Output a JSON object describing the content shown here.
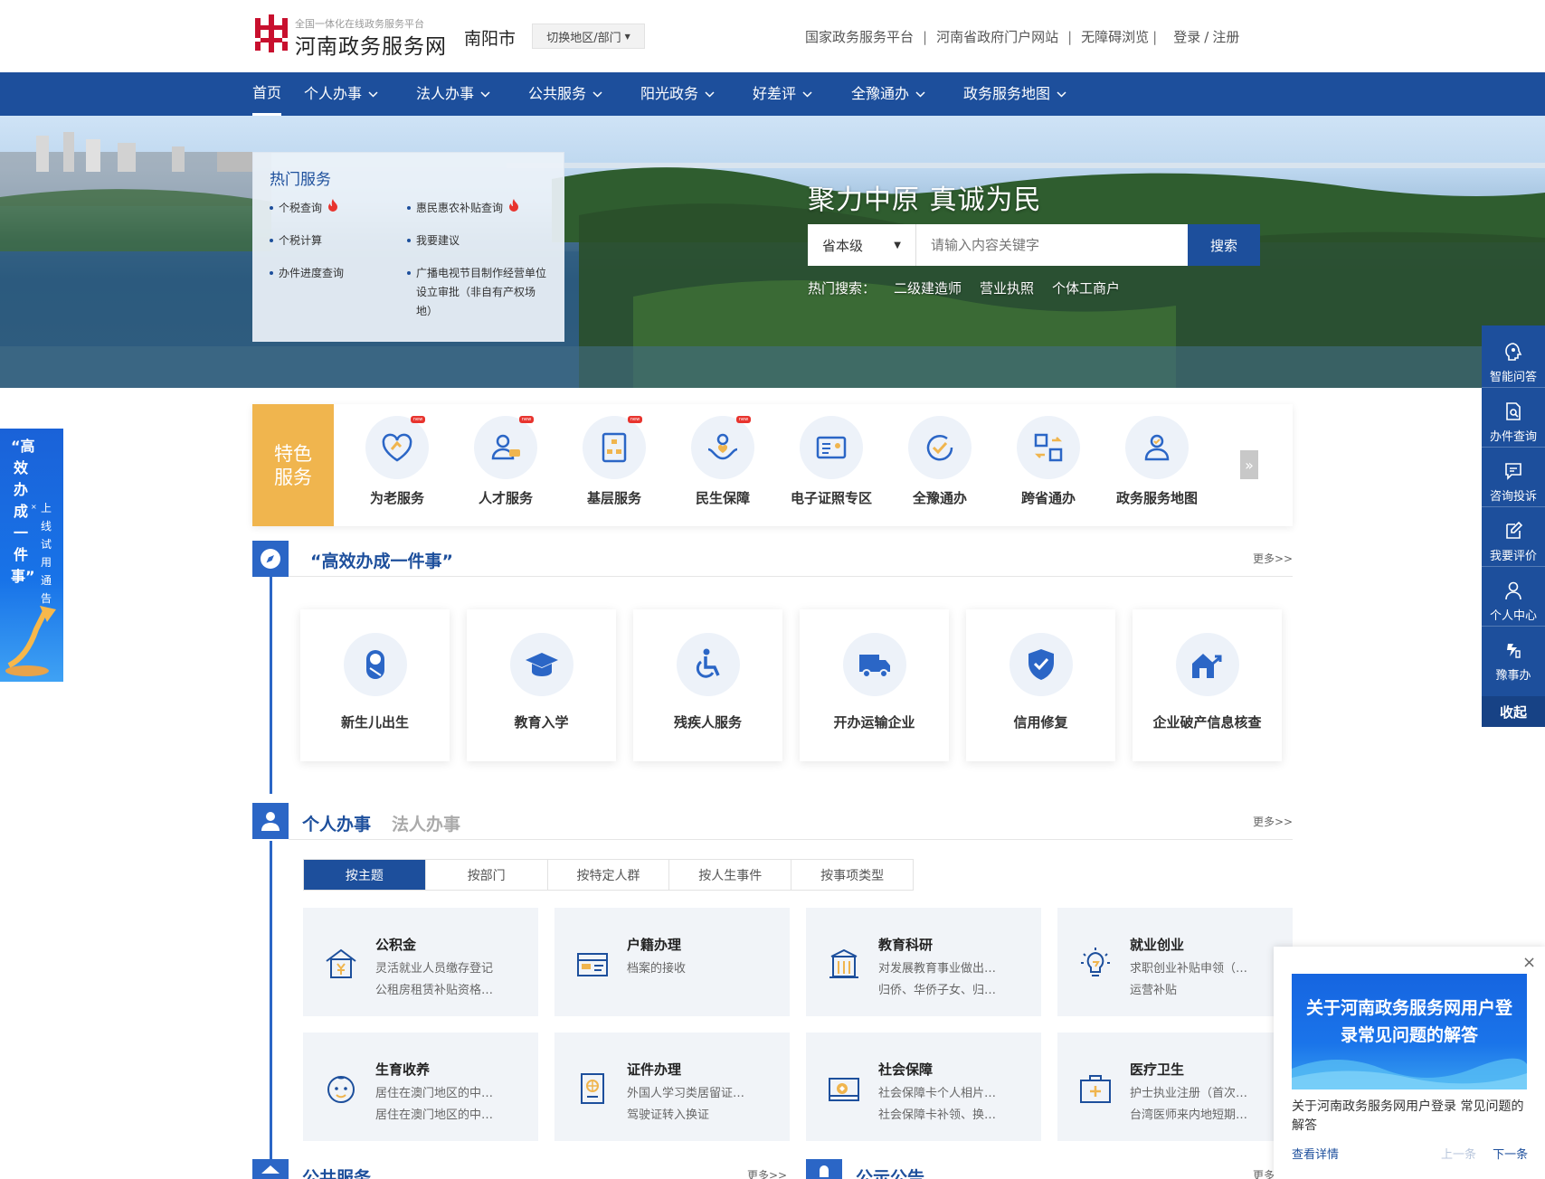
{
  "header": {
    "logo_sub": "全国一体化在线政务服务平台",
    "logo_title": "河南政务服务网",
    "city": "南阳市",
    "switch_label": "切换地区/部门",
    "links": [
      "国家政务服务平台",
      "河南省政府门户网站",
      "无障碍浏览"
    ],
    "login": "登录",
    "register": "注册"
  },
  "nav": {
    "items": [
      "首页",
      "个人办事",
      "法人办事",
      "公共服务",
      "阳光政务",
      "好差评",
      "全豫通办",
      "政务服务地图"
    ]
  },
  "hot_services": {
    "title": "热门服务",
    "items": [
      "个税查询",
      "惠民惠农补贴查询",
      "个税计算",
      "我要建议",
      "办件进度查询",
      "广播电视节目制作经营单位设立审批（非自有产权场地）"
    ]
  },
  "search": {
    "slogan": "聚力中原  真诚为民",
    "level": "省本级",
    "placeholder": "请输入内容关键字",
    "button": "搜索",
    "hot_label": "热门搜索：",
    "hot_terms": [
      "二级建造师",
      "营业执照",
      "个体工商户"
    ]
  },
  "featured": {
    "label_line1": "特色",
    "label_line2": "服务",
    "items": [
      "为老服务",
      "人才服务",
      "基层服务",
      "民生保障",
      "电子证照专区",
      "全豫通办",
      "跨省通办",
      "政务服务地图"
    ],
    "badge": "new"
  },
  "one_thing": {
    "title": "“高效办成一件事”",
    "more": "更多>>",
    "items": [
      "新生儿出生",
      "教育入学",
      "残疾人服务",
      "开办运输企业",
      "信用修复",
      "企业破产信息核查"
    ]
  },
  "affairs": {
    "title_active": "个人办事",
    "title_inactive": "法人办事",
    "more": "更多>>",
    "tabs": [
      "按主题",
      "按部门",
      "按特定人群",
      "按人生事件",
      "按事项类型"
    ],
    "cards": [
      {
        "title": "公积金",
        "line1": "灵活就业人员缴存登记",
        "line2": "公租房租赁补贴资格…"
      },
      {
        "title": "户籍办理",
        "line1": "档案的接收",
        "line2": ""
      },
      {
        "title": "教育科研",
        "line1": "对发展教育事业做出…",
        "line2": "归侨、华侨子女、归…"
      },
      {
        "title": "就业创业",
        "line1": "求职创业补贴申领（…",
        "line2": "运营补贴"
      },
      {
        "title": "生育收养",
        "line1": "居住在澳门地区的中…",
        "line2": "居住在澳门地区的中…"
      },
      {
        "title": "证件办理",
        "line1": "外国人学习类居留证…",
        "line2": "驾驶证转入换证"
      },
      {
        "title": "社会保障",
        "line1": "社会保障卡个人相片…",
        "line2": "社会保障卡补领、换…"
      },
      {
        "title": "医疗卫生",
        "line1": "护士执业注册（首次…",
        "line2": "台湾医师来内地短期…"
      }
    ]
  },
  "bottom_sections": {
    "public_service": "公共服务",
    "public_more": "更多>>",
    "notice": "公示公告",
    "notice_more": "更多"
  },
  "left_float": {
    "big": "“高效办成一件事”",
    "small": "上线试用通告"
  },
  "right_float": {
    "items": [
      "智能问答",
      "办件查询",
      "咨询投诉",
      "我要评价",
      "个人中心",
      "豫事办"
    ],
    "collapse": "收起"
  },
  "popup": {
    "image_text": "关于河南政务服务网用户登录常见问题的解答",
    "text": "关于河南政务服务网用户登录 常见问题的解答",
    "link": "查看详情",
    "prev": "上一条",
    "next": "下一条"
  },
  "colors": {
    "primary": "#1d4f9c",
    "accent": "#2b66c6",
    "featured_label": "#f0b54e",
    "hot_fire": "#e8342e"
  }
}
